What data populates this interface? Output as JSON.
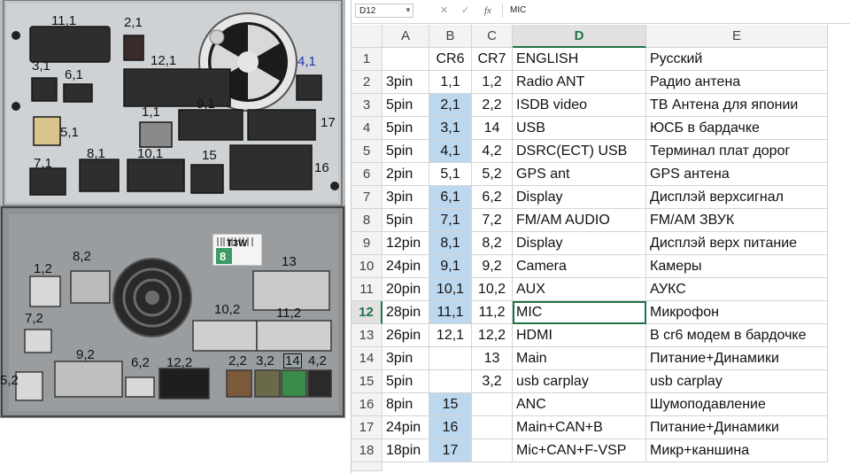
{
  "photo_labels": {
    "top": [
      "11,1",
      "2,1",
      "3,1",
      "6,1",
      "12,1",
      "4,1",
      "9,1",
      "1,1",
      "17",
      "5,1",
      "7,1",
      "8,1",
      "10,1",
      "15",
      "16"
    ],
    "bottom": [
      "1,2",
      "8,2",
      "13",
      "7,2",
      "10,2",
      "11,2",
      "9,2",
      "6,2",
      "12,2",
      "2,2",
      "3,2",
      "14",
      "4,2",
      "5,2"
    ],
    "sticker": "T3W",
    "sticker_num": "8"
  },
  "spreadsheet": {
    "name_box": "D12",
    "cancel_icon": "✕",
    "enter_icon": "✓",
    "fx_label": "fx",
    "formula": "MIC",
    "columns": [
      "A",
      "B",
      "C",
      "D",
      "E"
    ],
    "active_column": "D",
    "active_row": "12",
    "rows": [
      {
        "num": "1",
        "a": "",
        "b": "CR6",
        "c": "CR7",
        "d": "ENGLISH",
        "e": "Русский",
        "hl": false
      },
      {
        "num": "2",
        "a": "3pin",
        "b": "1,1",
        "c": "1,2",
        "d": "Radio ANT",
        "e": "Радио антена",
        "hl": false
      },
      {
        "num": "3",
        "a": "5pin",
        "b": "2,1",
        "c": "2,2",
        "d": " ISDB video",
        "e": "ТВ Антена для японии",
        "hl": true
      },
      {
        "num": "4",
        "a": "5pin",
        "b": "3,1",
        "c": "14",
        "d": "USB",
        "e": "ЮСБ в бардачке",
        "hl": true
      },
      {
        "num": "5",
        "a": "5pin",
        "b": "4,1",
        "c": "4,2",
        "d": "DSRC(ECT) USB",
        "e": "Терминал плат дорог",
        "hl": true
      },
      {
        "num": "6",
        "a": "2pin",
        "b": "5,1",
        "c": "5,2",
        "d": "GPS ant",
        "e": "GPS антена",
        "hl": false
      },
      {
        "num": "7",
        "a": "3pin",
        "b": "6,1",
        "c": "6,2",
        "d": "Display",
        "e": "Дисплэй верхсигнал",
        "hl": true
      },
      {
        "num": "8",
        "a": "5pin",
        "b": "7,1",
        "c": "7,2",
        "d": "FM/AM AUDIO",
        "e": "FM/AM ЗВУК",
        "hl": true
      },
      {
        "num": "9",
        "a": "12pin",
        "b": "8,1",
        "c": "8,2",
        "d": "Display",
        "e": "Дисплэй верх питание",
        "hl": true
      },
      {
        "num": "10",
        "a": "24pin",
        "b": "9,1",
        "c": "9,2",
        "d": "Camera",
        "e": "Камеры",
        "hl": true
      },
      {
        "num": "11",
        "a": "20pin",
        "b": "10,1",
        "c": "10,2",
        "d": "AUX",
        "e": "АУКС",
        "hl": true
      },
      {
        "num": "12",
        "a": "28pin",
        "b": "11,1",
        "c": "11,2",
        "d": "MIC",
        "e": "Микрофон",
        "hl": true
      },
      {
        "num": "13",
        "a": "26pin",
        "b": "12,1",
        "c": "12,2",
        "d": "HDMI",
        "e": "В cr6  модем в бардочке",
        "hl": false
      },
      {
        "num": "14",
        "a": "3pin",
        "b": "",
        "c": "13",
        "d": "Main",
        "e": "Питание+Динамики",
        "hl": false
      },
      {
        "num": "15",
        "a": "5pin",
        "b": "",
        "c": "3,2",
        "d": "usb carplay",
        "e": "usb carplay",
        "hl": false
      },
      {
        "num": "16",
        "a": "8pin",
        "b": "15",
        "c": "",
        "d": "ANC",
        "e": "Шумоподавление",
        "hl": true
      },
      {
        "num": "17",
        "a": "24pin",
        "b": "16",
        "c": "",
        "d": "Main+CAN+B",
        "e": "Питание+Динамики",
        "hl": true
      },
      {
        "num": "18",
        "a": "18pin",
        "b": "17",
        "c": "",
        "d": "Mic+CAN+F-VSP",
        "e": "Микр+каншина",
        "hl": true
      }
    ]
  },
  "colors": {
    "highlight": "#bdd7ee",
    "excel_green": "#217346"
  }
}
